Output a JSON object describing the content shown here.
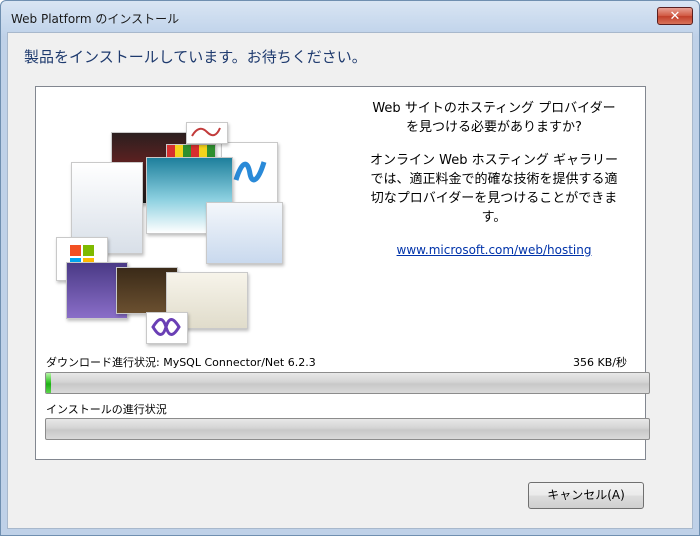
{
  "window": {
    "title": "Web Platform のインストール",
    "close_label": "✕"
  },
  "heading": "製品をインストールしています。お待ちください。",
  "promo": {
    "line1": "Web サイトのホスティング プロバイダーを見つける必要がありますか?",
    "line2": "オンライン Web ホスティング ギャラリーでは、適正料金で的確な技術を提供する適切なプロバイダーを見つけることができます。",
    "link": "www.microsoft.com/web/hosting"
  },
  "download": {
    "label": "ダウンロード進行状況: MySQL Connector/Net 6.2.3",
    "speed": "356 KB/秒",
    "progress": 0.008
  },
  "install": {
    "label": "インストールの進行状況",
    "progress": 0
  },
  "buttons": {
    "cancel": "キャンセル(A)"
  },
  "colors": {
    "accent": "#1e3a6e",
    "progress_green": "#1fae16",
    "link": "#0033aa"
  }
}
